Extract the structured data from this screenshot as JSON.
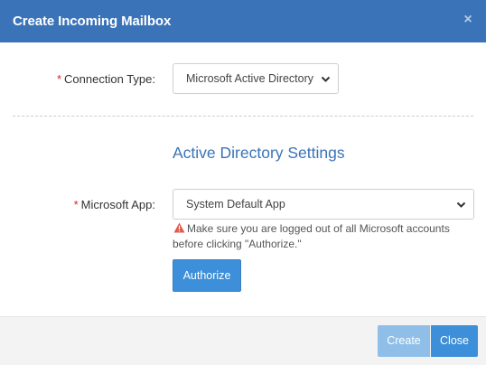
{
  "header": {
    "title": "Create Incoming Mailbox",
    "close_glyph": "×"
  },
  "form": {
    "connection_type": {
      "required_mark": "*",
      "label": "Connection Type:",
      "value": "Microsoft Active Directory"
    },
    "section_title": "Active Directory Settings",
    "microsoft_app": {
      "required_mark": "*",
      "label": "Microsoft App:",
      "value": "System Default App"
    },
    "warning": {
      "icon": "warning-triangle-icon",
      "line1": "Make sure you are logged out of all Microsoft accounts",
      "line2": "before clicking \"Authorize.\""
    },
    "authorize_label": "Authorize"
  },
  "footer": {
    "create_label": "Create",
    "close_label": "Close"
  },
  "colors": {
    "header_bg": "#3a73b8",
    "accent": "#3c8fd8",
    "create_disabled": "#8fbfe8",
    "required": "#d9232e",
    "warning": "#e05a4e"
  }
}
